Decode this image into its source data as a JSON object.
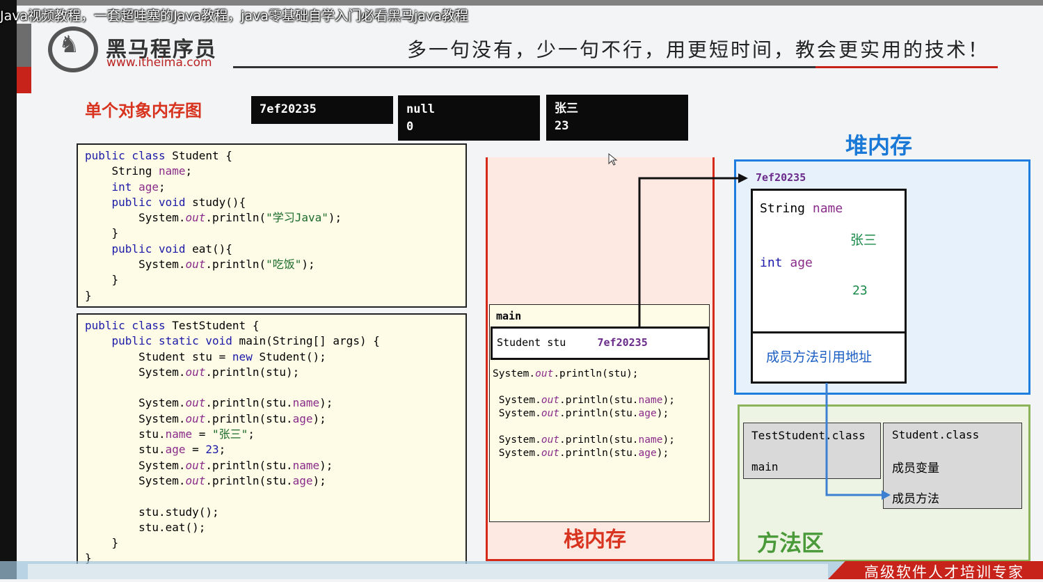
{
  "video_title": "Java视频教程，一套超哇塞的Java教程，java零基础自学入门必看黑马java教程",
  "brand": {
    "name": "黑马程序员",
    "url": "www.itheima.com",
    "logo_icon": "horse-head-icon"
  },
  "slogan": "多一句没有，少一句不行，用更短时间，教会更实用的技术！",
  "section_title": "单个对象内存图",
  "console_boxes": [
    {
      "lines": [
        "7ef20235"
      ]
    },
    {
      "lines": [
        "null",
        "0"
      ]
    },
    {
      "lines": [
        "张三",
        "23"
      ]
    }
  ],
  "student_class_code": [
    "public class Student {",
    "    String name;",
    "    int age;",
    "    public void study(){",
    "        System.out.println(\"学习Java\");",
    "    }",
    "    public void eat(){",
    "        System.out.println(\"吃饭\");",
    "    }",
    "}"
  ],
  "test_class_code": [
    "public class TestStudent {",
    "    public static void main(String[] args) {",
    "        Student stu = new Student();",
    "        System.out.println(stu);",
    "",
    "        System.out.println(stu.name);",
    "        System.out.println(stu.age);",
    "        stu.name = \"张三\";",
    "        stu.age = 23;",
    "        System.out.println(stu.name);",
    "        System.out.println(stu.age);",
    "",
    "        stu.study();",
    "        stu.eat();",
    "    }",
    "}"
  ],
  "stack": {
    "label": "栈内存",
    "frame_name": "main",
    "variable_decl": "Student stu",
    "variable_value": "7ef20235",
    "code": [
      "System.out.println(stu);",
      "",
      "System.out.println(stu.name);",
      "System.out.println(stu.age);",
      "",
      "System.out.println(stu.name);",
      "System.out.println(stu.age);"
    ]
  },
  "heap": {
    "label": "堆内存",
    "address": "7ef20235",
    "field1_type": "String",
    "field1_name": "name",
    "field1_value": "张三",
    "field2_type": "int",
    "field2_name": "age",
    "field2_value": "23",
    "method_ref": "成员方法引用地址"
  },
  "method_area": {
    "label": "方法区",
    "test_class": {
      "name": "TestStudent.class",
      "method": "main"
    },
    "student_class": {
      "name": "Student.class",
      "members": "成员变量",
      "methods": "成员方法"
    }
  },
  "footer_slogan": "高级软件人才培训专家",
  "colors": {
    "accent_red": "#d7331f",
    "heap_blue": "#1d7ee0",
    "method_green": "#8bb35a",
    "code_bg": "#fefbe6"
  }
}
